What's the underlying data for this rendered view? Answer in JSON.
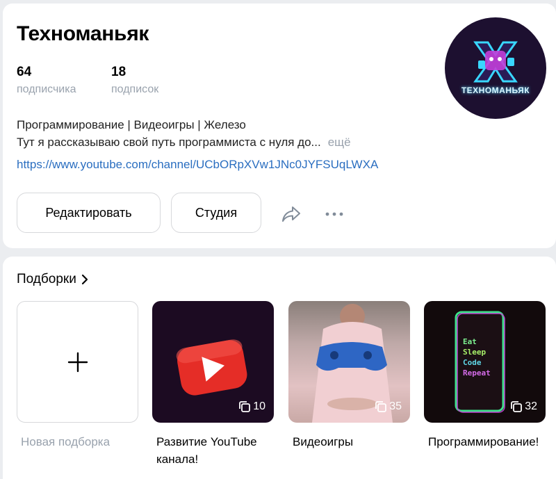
{
  "profile": {
    "name": "Техноманьяк",
    "stats": [
      {
        "value": "64",
        "label": "подписчика"
      },
      {
        "value": "18",
        "label": "подписок"
      }
    ],
    "avatar_text": "ТЕХНОМАНЬЯК",
    "description_line1": "Программирование | Видеоигры | Железо",
    "description_line2": "Тут я рассказываю свой путь программиста с нуля до...",
    "more_label": "ещё",
    "link": "https://www.youtube.com/channel/UCbORpXVw1JNc0JYFSUqLWXA",
    "buttons": {
      "edit": "Редактировать",
      "studio": "Студия"
    },
    "icons": [
      "share-icon",
      "more-icon"
    ]
  },
  "collections": {
    "title": "Подборки",
    "new_label": "Новая подборка",
    "items": [
      {
        "label": "Развитие YouTube канала!",
        "count": "10"
      },
      {
        "label": "Видеоигры",
        "count": "35"
      },
      {
        "label": "Программирование!",
        "count": "32"
      }
    ],
    "poster_text": [
      "Eat",
      "Sleep",
      "Code",
      "Repeat"
    ]
  },
  "colors": {
    "link": "#2a6ec0",
    "muted": "#99a2ad",
    "background": "#ebedf0",
    "youtube_red": "#e52d27"
  }
}
